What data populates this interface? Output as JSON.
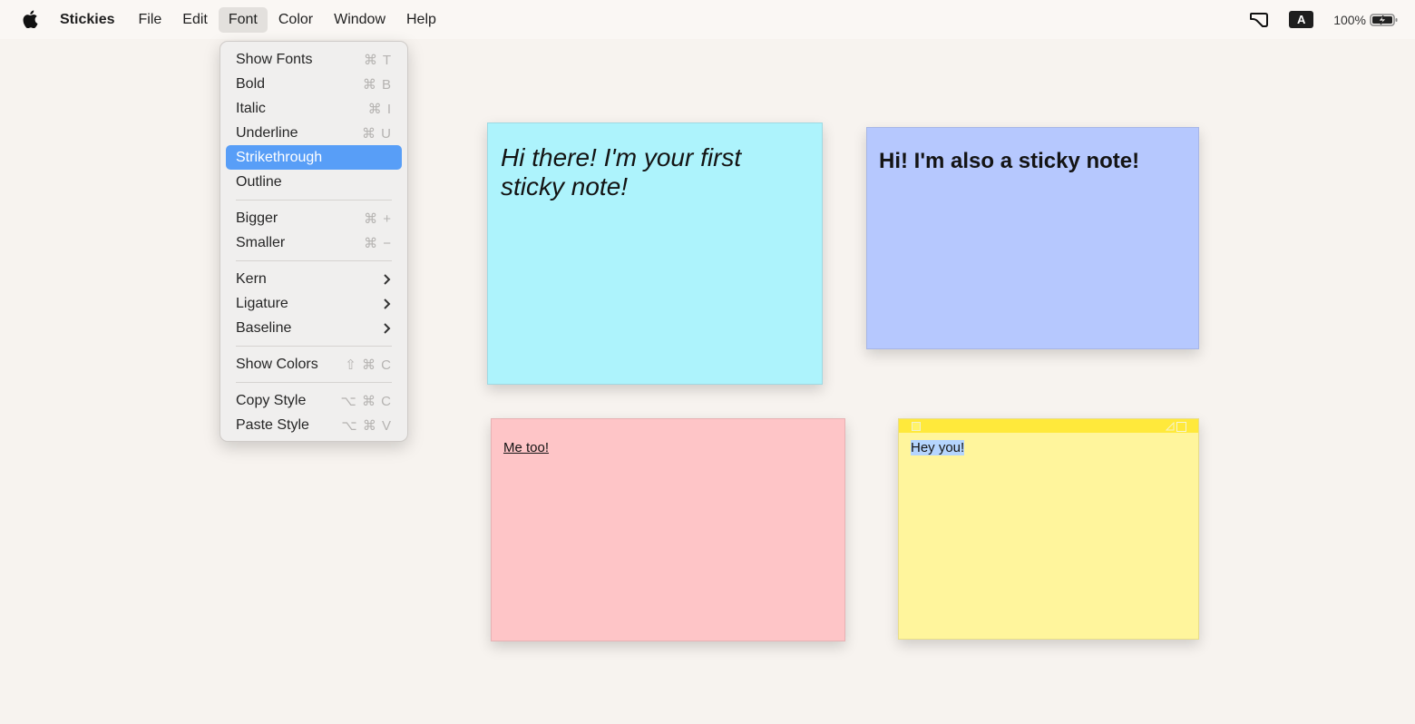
{
  "menubar": {
    "app_name": "Stickies",
    "menus": [
      "File",
      "Edit",
      "Font",
      "Color",
      "Window",
      "Help"
    ],
    "active_menu": "Font",
    "status": {
      "input_source": "A",
      "battery_percent": "100%"
    }
  },
  "font_menu": {
    "items": [
      {
        "label": "Show Fonts",
        "shortcut": "⌘ T"
      },
      {
        "label": "Bold",
        "shortcut": "⌘ B"
      },
      {
        "label": "Italic",
        "shortcut": "⌘ I"
      },
      {
        "label": "Underline",
        "shortcut": "⌘ U"
      },
      {
        "label": "Strikethrough",
        "shortcut": "",
        "highlighted": true
      },
      {
        "label": "Outline",
        "shortcut": ""
      },
      {
        "label": "Bigger",
        "shortcut": "⌘ +"
      },
      {
        "label": "Smaller",
        "shortcut": "⌘ −"
      },
      {
        "label": "Kern",
        "submenu": true
      },
      {
        "label": "Ligature",
        "submenu": true
      },
      {
        "label": "Baseline",
        "submenu": true
      },
      {
        "label": "Show Colors",
        "shortcut": "⇧ ⌘ C"
      },
      {
        "label": "Copy Style",
        "shortcut": "⌥ ⌘ C"
      },
      {
        "label": "Paste Style",
        "shortcut": "⌥ ⌘ V"
      }
    ]
  },
  "notes": [
    {
      "color": "#adf3fc",
      "text": "Hi there! I'm your first sticky note!",
      "style": "italic"
    },
    {
      "color": "#b6c8fe",
      "text": "Hi! I'm also a sticky note!",
      "style": "bold"
    },
    {
      "color": "#fec5c7",
      "text": "Me too!",
      "style": "underline"
    },
    {
      "color": "#fff59c",
      "text": "Hey you!",
      "style": "selected",
      "active": true
    }
  ]
}
